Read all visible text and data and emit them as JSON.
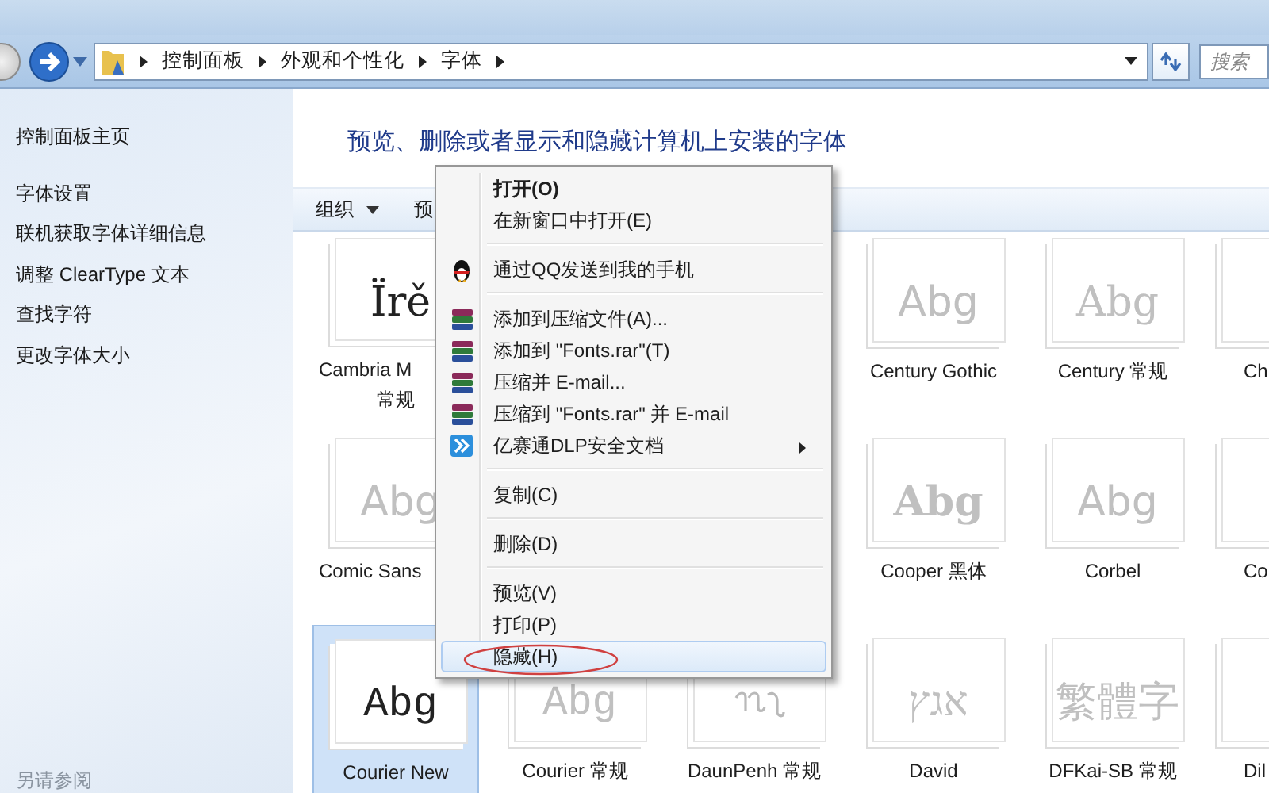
{
  "nav": {
    "breadcrumbs": [
      "控制面板",
      "外观和个性化",
      "字体"
    ],
    "search": {
      "placeholder": "搜索"
    }
  },
  "sidebar": {
    "items": [
      {
        "label": "控制面板主页",
        "kind": "home"
      },
      {
        "label": "字体设置",
        "kind": "link"
      },
      {
        "label": "联机获取字体详细信息",
        "kind": "link"
      },
      {
        "label": "调整 ClearType 文本",
        "kind": "link"
      },
      {
        "label": "查找字符",
        "kind": "link"
      },
      {
        "label": "更改字体大小",
        "kind": "link"
      }
    ],
    "see_also": "另请参阅"
  },
  "header": "预览、删除或者显示和隐藏计算机上安装的字体",
  "toolbar": {
    "items": [
      {
        "label": "组织",
        "dropdown": true
      },
      {
        "label": "预"
      }
    ]
  },
  "fonts": [
    [
      {
        "name": "Cambria M",
        "name_2": "常规",
        "sample": "Ïrě",
        "kind": "serif-dark",
        "selected": false
      },
      {
        "kind": "covered"
      },
      {
        "kind": "covered"
      },
      {
        "name": "Century Gothic",
        "sample": "Abg",
        "kind": "sans",
        "selected": false
      },
      {
        "name": "Century 常规",
        "sample": "Abg",
        "kind": "serif",
        "selected": false
      },
      {
        "name": "Ch",
        "kind": "none",
        "selected": false
      }
    ],
    [
      {
        "name": "Comic Sans",
        "sample": "Abg",
        "kind": "sans",
        "selected": false
      },
      {
        "kind": "covered"
      },
      {
        "kind": "covered"
      },
      {
        "name": "Cooper 黑体",
        "sample": "Abg",
        "kind": "bold-serif",
        "selected": false
      },
      {
        "name": "Corbel",
        "sample": "Abg",
        "kind": "sans",
        "selected": false
      },
      {
        "name": "Co",
        "kind": "none",
        "selected": false
      }
    ],
    [
      {
        "name": "Courier New",
        "sample": "Abg",
        "kind": "mono-dark",
        "selected": true
      },
      {
        "name": "Courier 常规",
        "sample": "Abg",
        "kind": "mono",
        "selected": false
      },
      {
        "name": "DaunPenh 常规",
        "kind": "glyph",
        "selected": false
      },
      {
        "name": "David",
        "sample": "אגץ",
        "kind": "serif",
        "selected": false
      },
      {
        "name": "DFKai-SB 常规",
        "sample": "繁體字",
        "kind": "serif",
        "selected": false
      },
      {
        "name": "Dil",
        "kind": "none",
        "selected": false
      }
    ]
  ],
  "menu": [
    {
      "kind": "item",
      "label": "打开(O)",
      "default": true,
      "selected": false
    },
    {
      "kind": "item",
      "label": "在新窗口中打开(E)",
      "selected": false
    },
    {
      "kind": "separator"
    },
    {
      "kind": "penguin",
      "label": "通过QQ发送到我的手机",
      "selected": false
    },
    {
      "kind": "separator"
    },
    {
      "kind": "archive",
      "label": "添加到压缩文件(A)...",
      "selected": false
    },
    {
      "kind": "archive",
      "label": "添加到 \"Fonts.rar\"(T)",
      "selected": false
    },
    {
      "kind": "archive",
      "label": "压缩并 E-mail...",
      "selected": false
    },
    {
      "kind": "archive",
      "label": "压缩到 \"Fonts.rar\" 并 E-mail",
      "selected": false
    },
    {
      "kind": "chevron",
      "label": "亿赛通DLP安全文档",
      "submenu": true,
      "selected": false
    },
    {
      "kind": "separator"
    },
    {
      "kind": "item",
      "label": "复制(C)",
      "selected": false
    },
    {
      "kind": "separator"
    },
    {
      "kind": "item",
      "label": "删除(D)",
      "selected": false
    },
    {
      "kind": "separator"
    },
    {
      "kind": "item",
      "label": "预览(V)",
      "selected": false
    },
    {
      "kind": "item",
      "label": "打印(P)",
      "selected": false
    },
    {
      "kind": "item",
      "label": "隐藏(H)",
      "selected": true,
      "circled": true
    }
  ]
}
